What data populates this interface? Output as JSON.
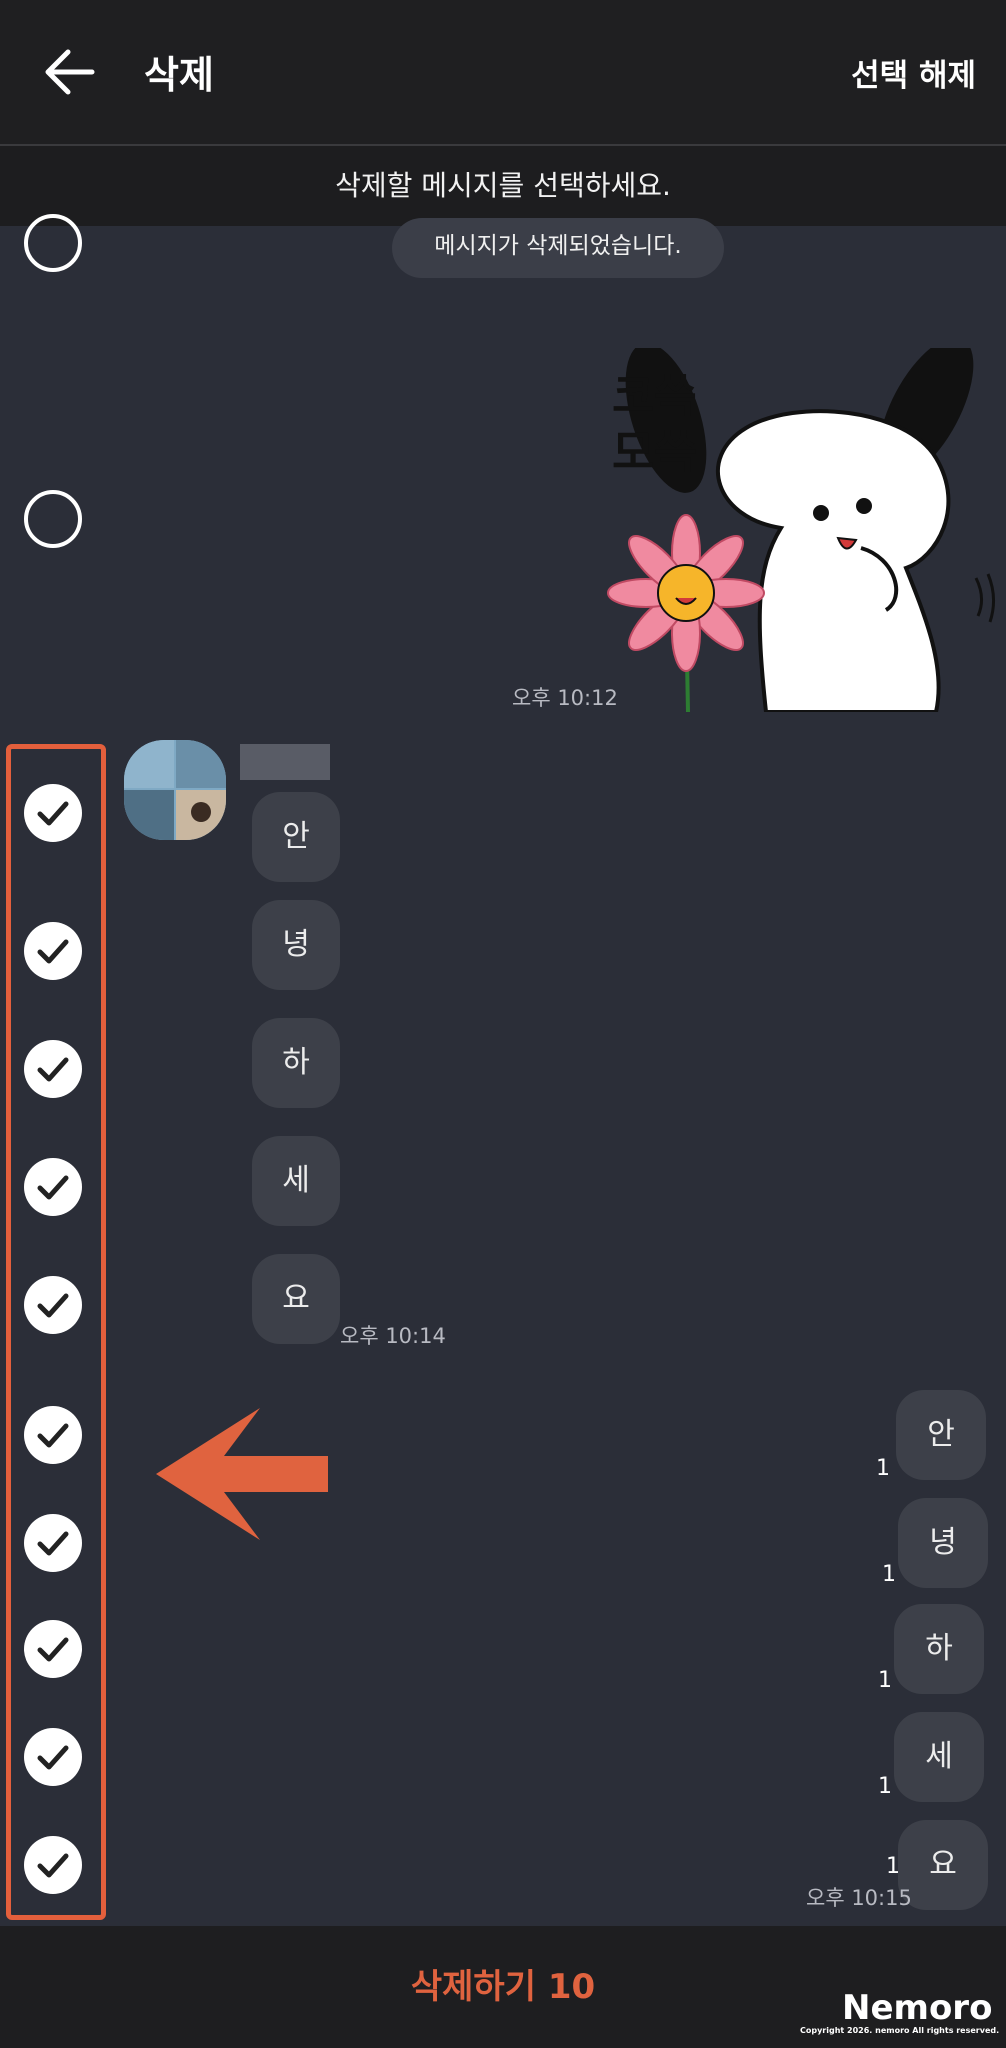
{
  "header": {
    "title": "삭제",
    "deselect_label": "선택 해제"
  },
  "instruction": "삭제할 메시지를 선택하세요.",
  "system_message": "메시지가 삭제되었습니다.",
  "sticker_text": "코쓱 모쓱",
  "sticker_time": "오후 10:12",
  "incoming": {
    "bubbles": [
      "안",
      "녕",
      "하",
      "세",
      "요"
    ],
    "time": "오후 10:14"
  },
  "outgoing": {
    "bubbles": [
      "안",
      "녕",
      "하",
      "세",
      "요"
    ],
    "unread": [
      "1",
      "1",
      "1",
      "1",
      "1"
    ],
    "time": "오후 10:15"
  },
  "bottom": {
    "delete_label": "삭제하기 10"
  },
  "watermark": {
    "brand": "Nemoro",
    "copyright": "Copyright 2026. nemoro All rights reserved."
  },
  "colors": {
    "accent": "#e35f3c",
    "background": "#2b2e38",
    "bar": "#1f1f21"
  },
  "selection": {
    "selected_count": 10
  }
}
